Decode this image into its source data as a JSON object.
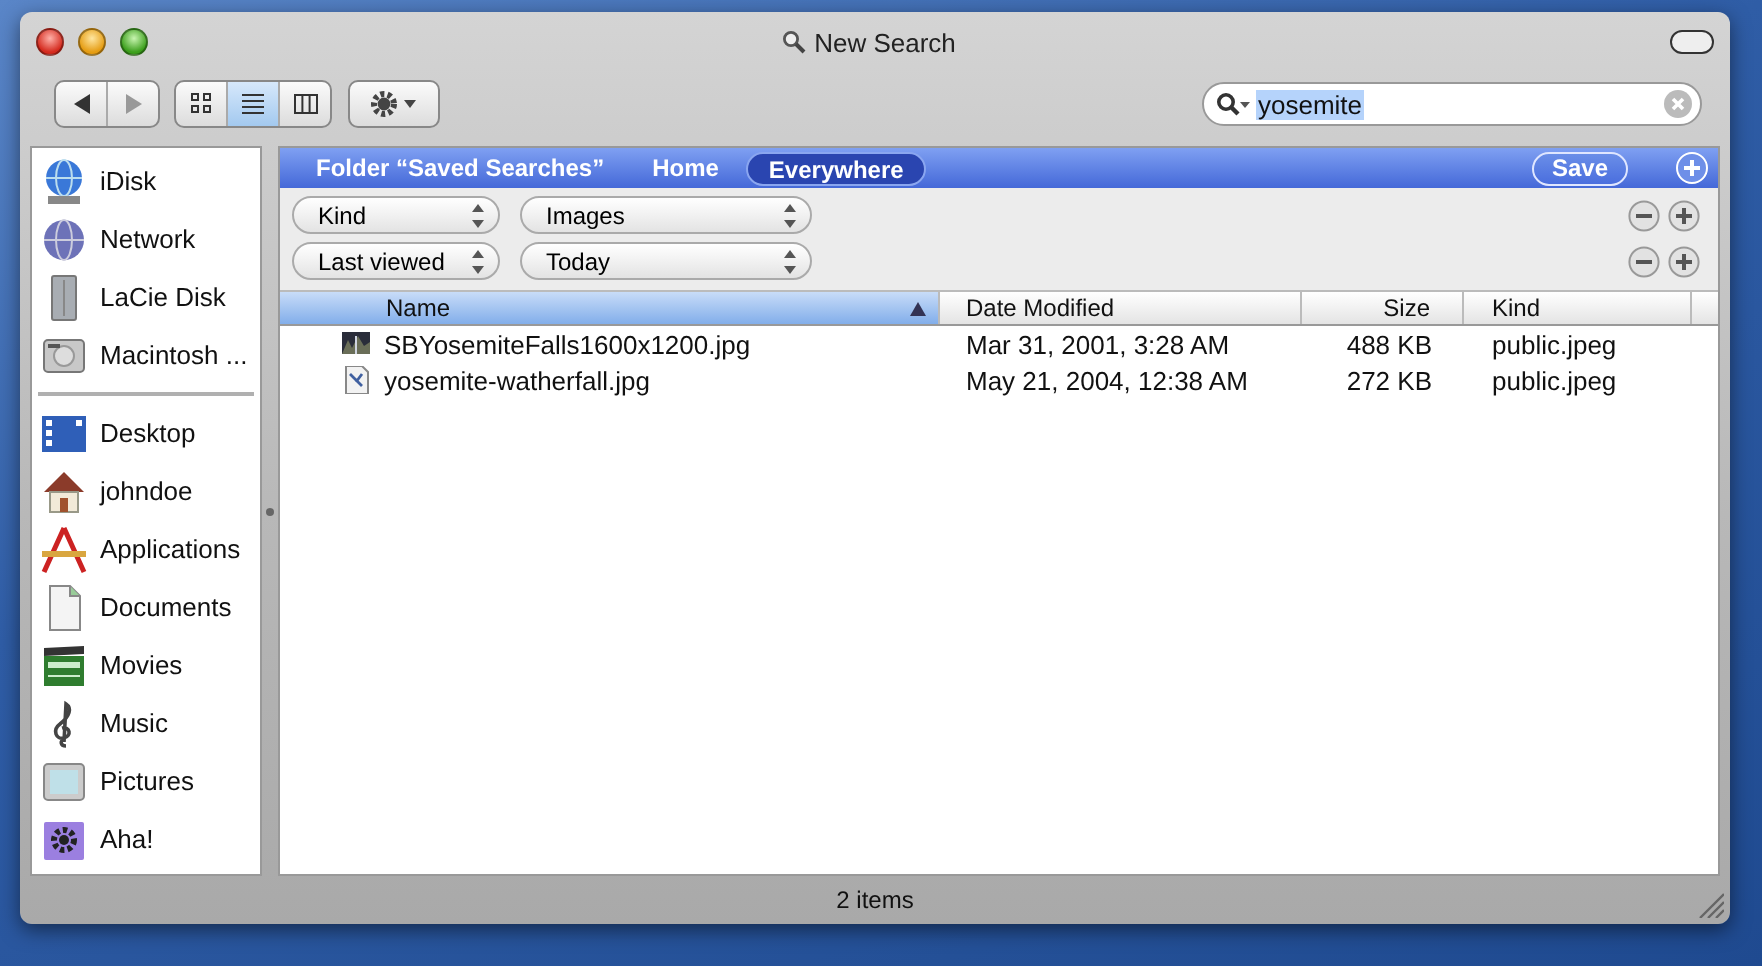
{
  "window": {
    "title": "New Search"
  },
  "toolbar": {
    "view_modes": [
      {
        "selected": false
      },
      {
        "selected": true
      },
      {
        "selected": false
      }
    ],
    "search": {
      "value": "yosemite",
      "text_selected": true
    }
  },
  "sidebar": {
    "sections": [
      {
        "items": [
          {
            "label": "iDisk"
          },
          {
            "label": "Network"
          },
          {
            "label": "LaCie Disk"
          },
          {
            "label": "Macintosh ..."
          }
        ]
      },
      {
        "items": [
          {
            "label": "Desktop"
          },
          {
            "label": "johndoe"
          },
          {
            "label": "Applications"
          },
          {
            "label": "Documents"
          },
          {
            "label": "Movies"
          },
          {
            "label": "Music"
          },
          {
            "label": "Pictures"
          },
          {
            "label": "Aha!"
          }
        ]
      }
    ]
  },
  "scope_bar": {
    "scopes": [
      {
        "label": "Folder “Saved Searches”",
        "selected": false
      },
      {
        "label": "Home",
        "selected": false
      },
      {
        "label": "Everywhere",
        "selected": true
      }
    ],
    "save_button": "Save"
  },
  "criteria": [
    {
      "attribute": "Kind",
      "value": "Images"
    },
    {
      "attribute": "Last viewed",
      "value": "Today"
    }
  ],
  "table": {
    "columns": [
      {
        "label": "Name",
        "sorted": true
      },
      {
        "label": "Date Modified",
        "sorted": false
      },
      {
        "label": "Size",
        "sorted": false
      },
      {
        "label": "Kind",
        "sorted": false
      }
    ],
    "rows": [
      {
        "kind": "photo",
        "name": "SBYosemiteFalls1600x1200.jpg",
        "date_modified": "Mar 31, 2001, 3:28 AM",
        "size": "488 KB",
        "file_kind": "public.jpeg"
      },
      {
        "kind": "document",
        "name": "yosemite-watherfall.jpg",
        "date_modified": "May 21, 2004, 12:38 AM",
        "size": "272 KB",
        "file_kind": "public.jpeg"
      }
    ]
  },
  "status_bar": "2 items"
}
